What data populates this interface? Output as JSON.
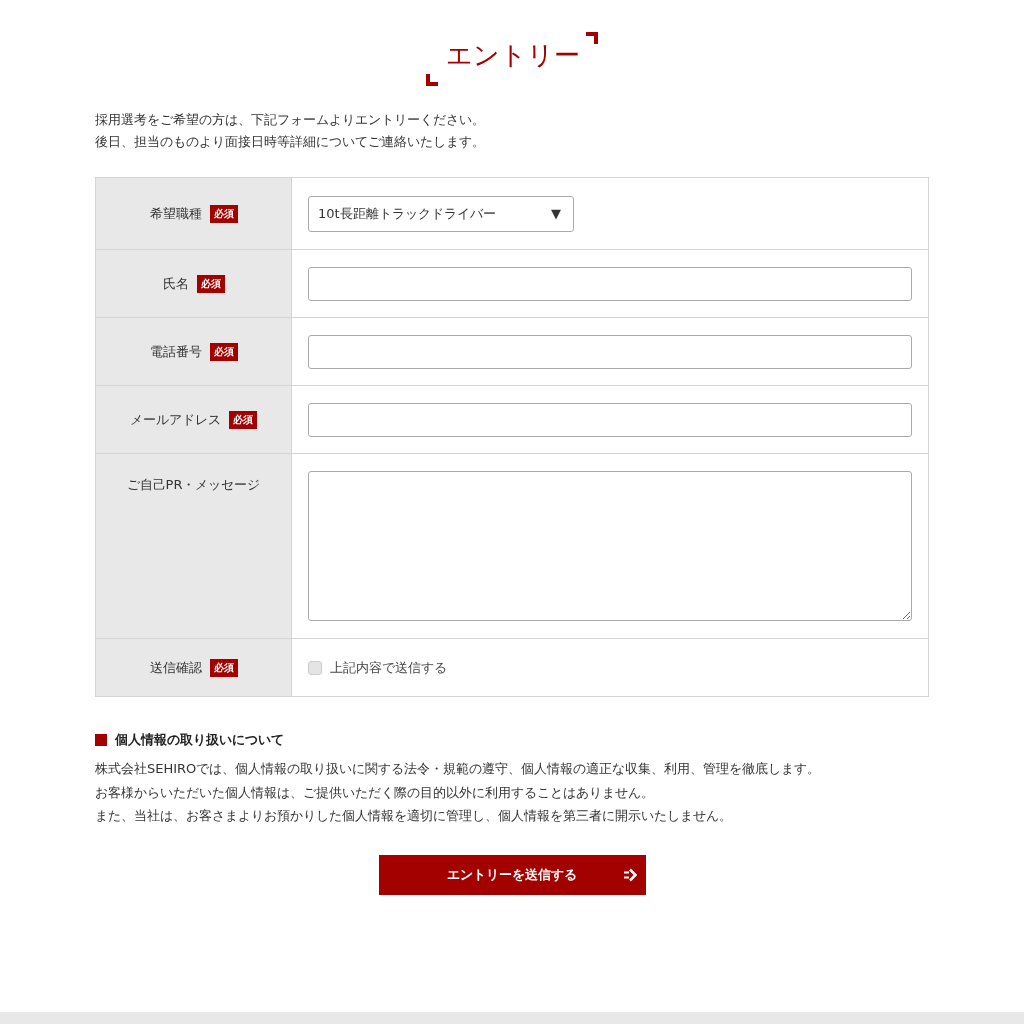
{
  "title": "エントリー",
  "intro": [
    "採用選考をご希望の方は、下記フォームよりエントリーください。",
    "後日、担当のものより面接日時等詳細についてご連絡いたします。"
  ],
  "form": {
    "rows": [
      {
        "label": "希望職種",
        "badge": "必須",
        "kind": "select",
        "value": "10t長距離トラックドライバー",
        "caret": "▼"
      },
      {
        "label": "氏名",
        "badge": "必須",
        "kind": "text"
      },
      {
        "label": "電話番号",
        "badge": "必須",
        "kind": "text"
      },
      {
        "label": "メールアドレス",
        "badge": "必須",
        "kind": "text"
      },
      {
        "label": "ご自己PR・メッセージ",
        "kind": "textarea"
      },
      {
        "label": "送信確認",
        "badge": "必須",
        "kind": "checkbox",
        "option": "上記内容で送信する",
        "checked": false
      }
    ]
  },
  "privacy": {
    "heading": "個人情報の取り扱いについて",
    "lines": [
      "株式会社SEHIROでは、個人情報の取り扱いに関する法令・規範の遵守、個人情報の適正な収集、利用、管理を徹底します。",
      "お客様からいただいた個人情報は、ご提供いただく際の目的以外に利用することはありません。",
      "また、当社は、お客さまよりお預かりした個人情報を適切に管理し、個人情報を第三者に開示いたしません。"
    ]
  },
  "submit": {
    "label": "エントリーを送信する"
  }
}
